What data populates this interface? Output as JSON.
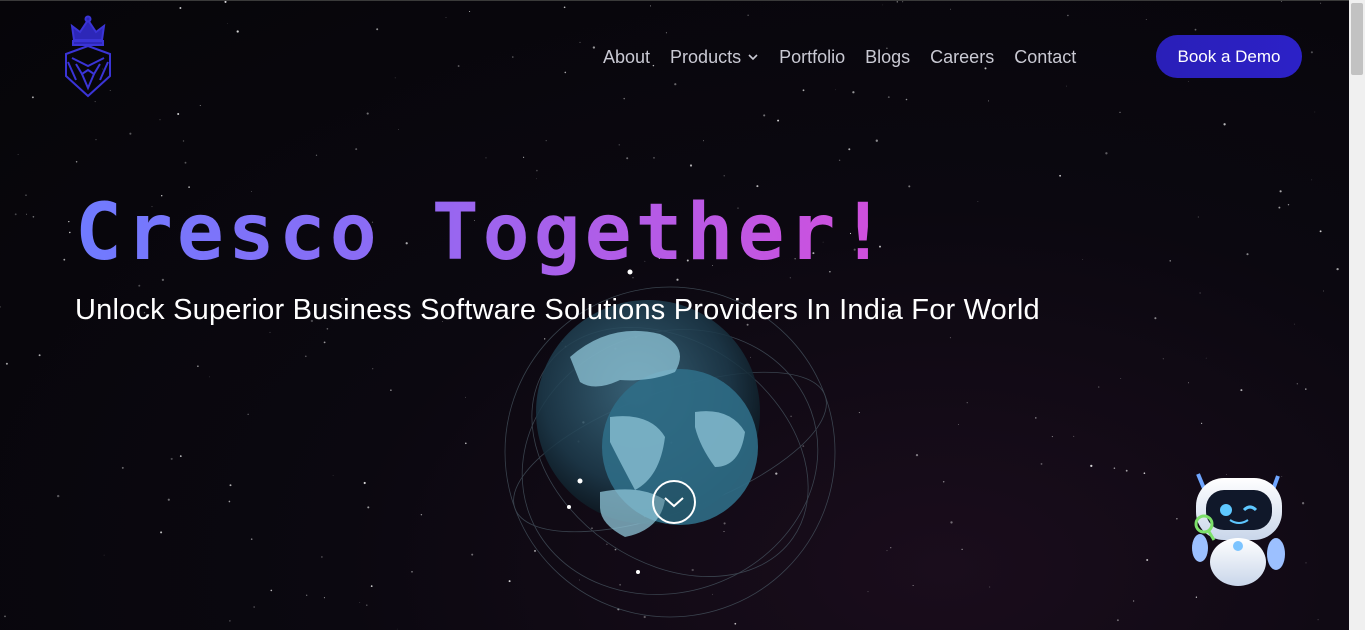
{
  "brand": {
    "logo_icon": "crown-lion-crest-icon",
    "accent": "#2a1fb8"
  },
  "nav": {
    "items": [
      {
        "label": "About"
      },
      {
        "label": "Products",
        "has_dropdown": true
      },
      {
        "label": "Portfolio"
      },
      {
        "label": "Blogs"
      },
      {
        "label": "Careers"
      },
      {
        "label": "Contact"
      }
    ],
    "cta_label": "Book a Demo"
  },
  "hero": {
    "title": "Cresco Together!",
    "subtitle": "Unlock Superior Business Software Solutions Providers In India For World",
    "title_gradient": [
      "#6f7bff",
      "#d14fdc"
    ],
    "scroll_icon": "chevron-down-circle-icon"
  },
  "assistant": {
    "icon": "robot-assistant-icon"
  }
}
